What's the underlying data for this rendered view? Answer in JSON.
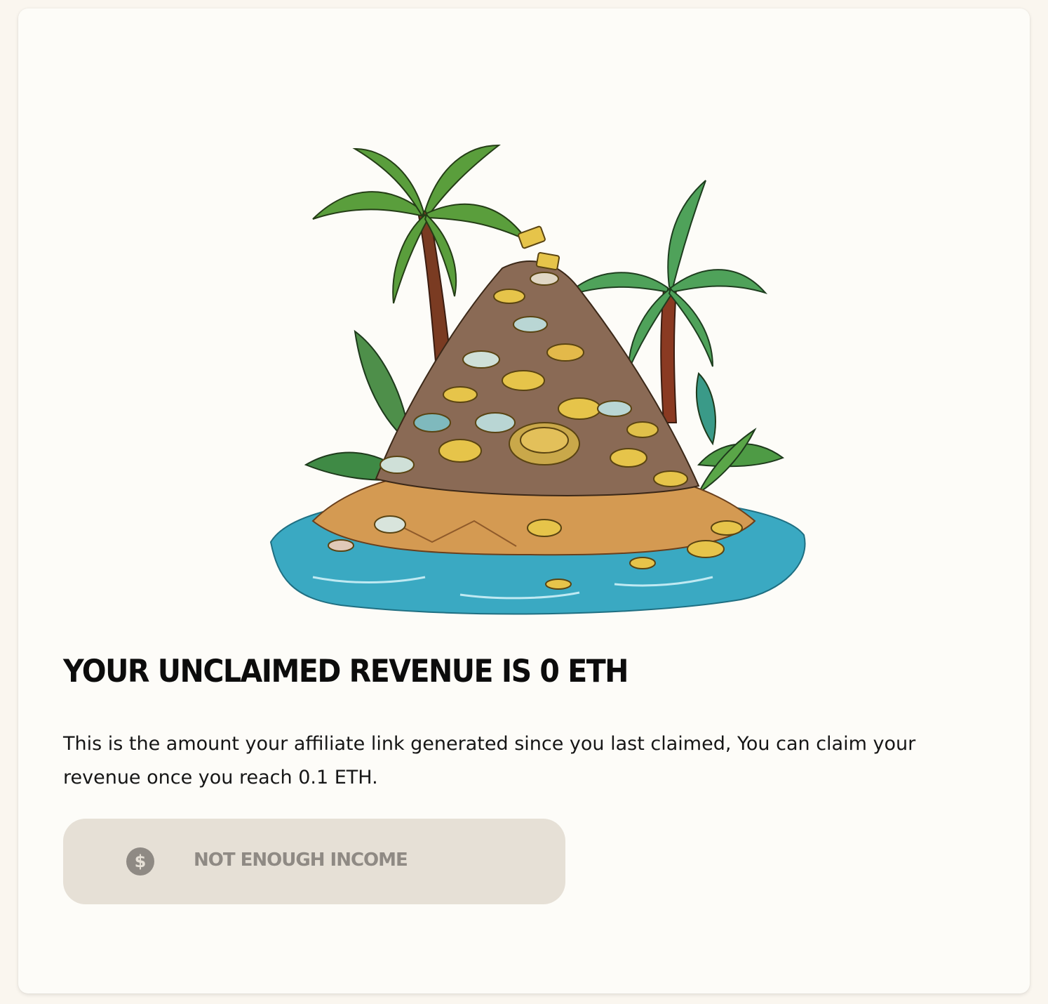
{
  "card": {
    "title": "YOUR UNCLAIMED REVENUE IS 0 ETH",
    "description": "This is the amount your affiliate link generated since you last claimed, You can claim your revenue once you reach 0.1 ETH.",
    "button": {
      "label": "NOT ENOUGH INCOME",
      "icon": "dollar-coin-icon",
      "disabled": true
    },
    "illustration": "treasure-island-illustration"
  },
  "colors": {
    "page_background": "#faf6ef",
    "card_background": "#fdfcf8",
    "button_background": "#e6e0d6",
    "button_text": "#8f8a84",
    "title_text": "#0c0c0c"
  }
}
